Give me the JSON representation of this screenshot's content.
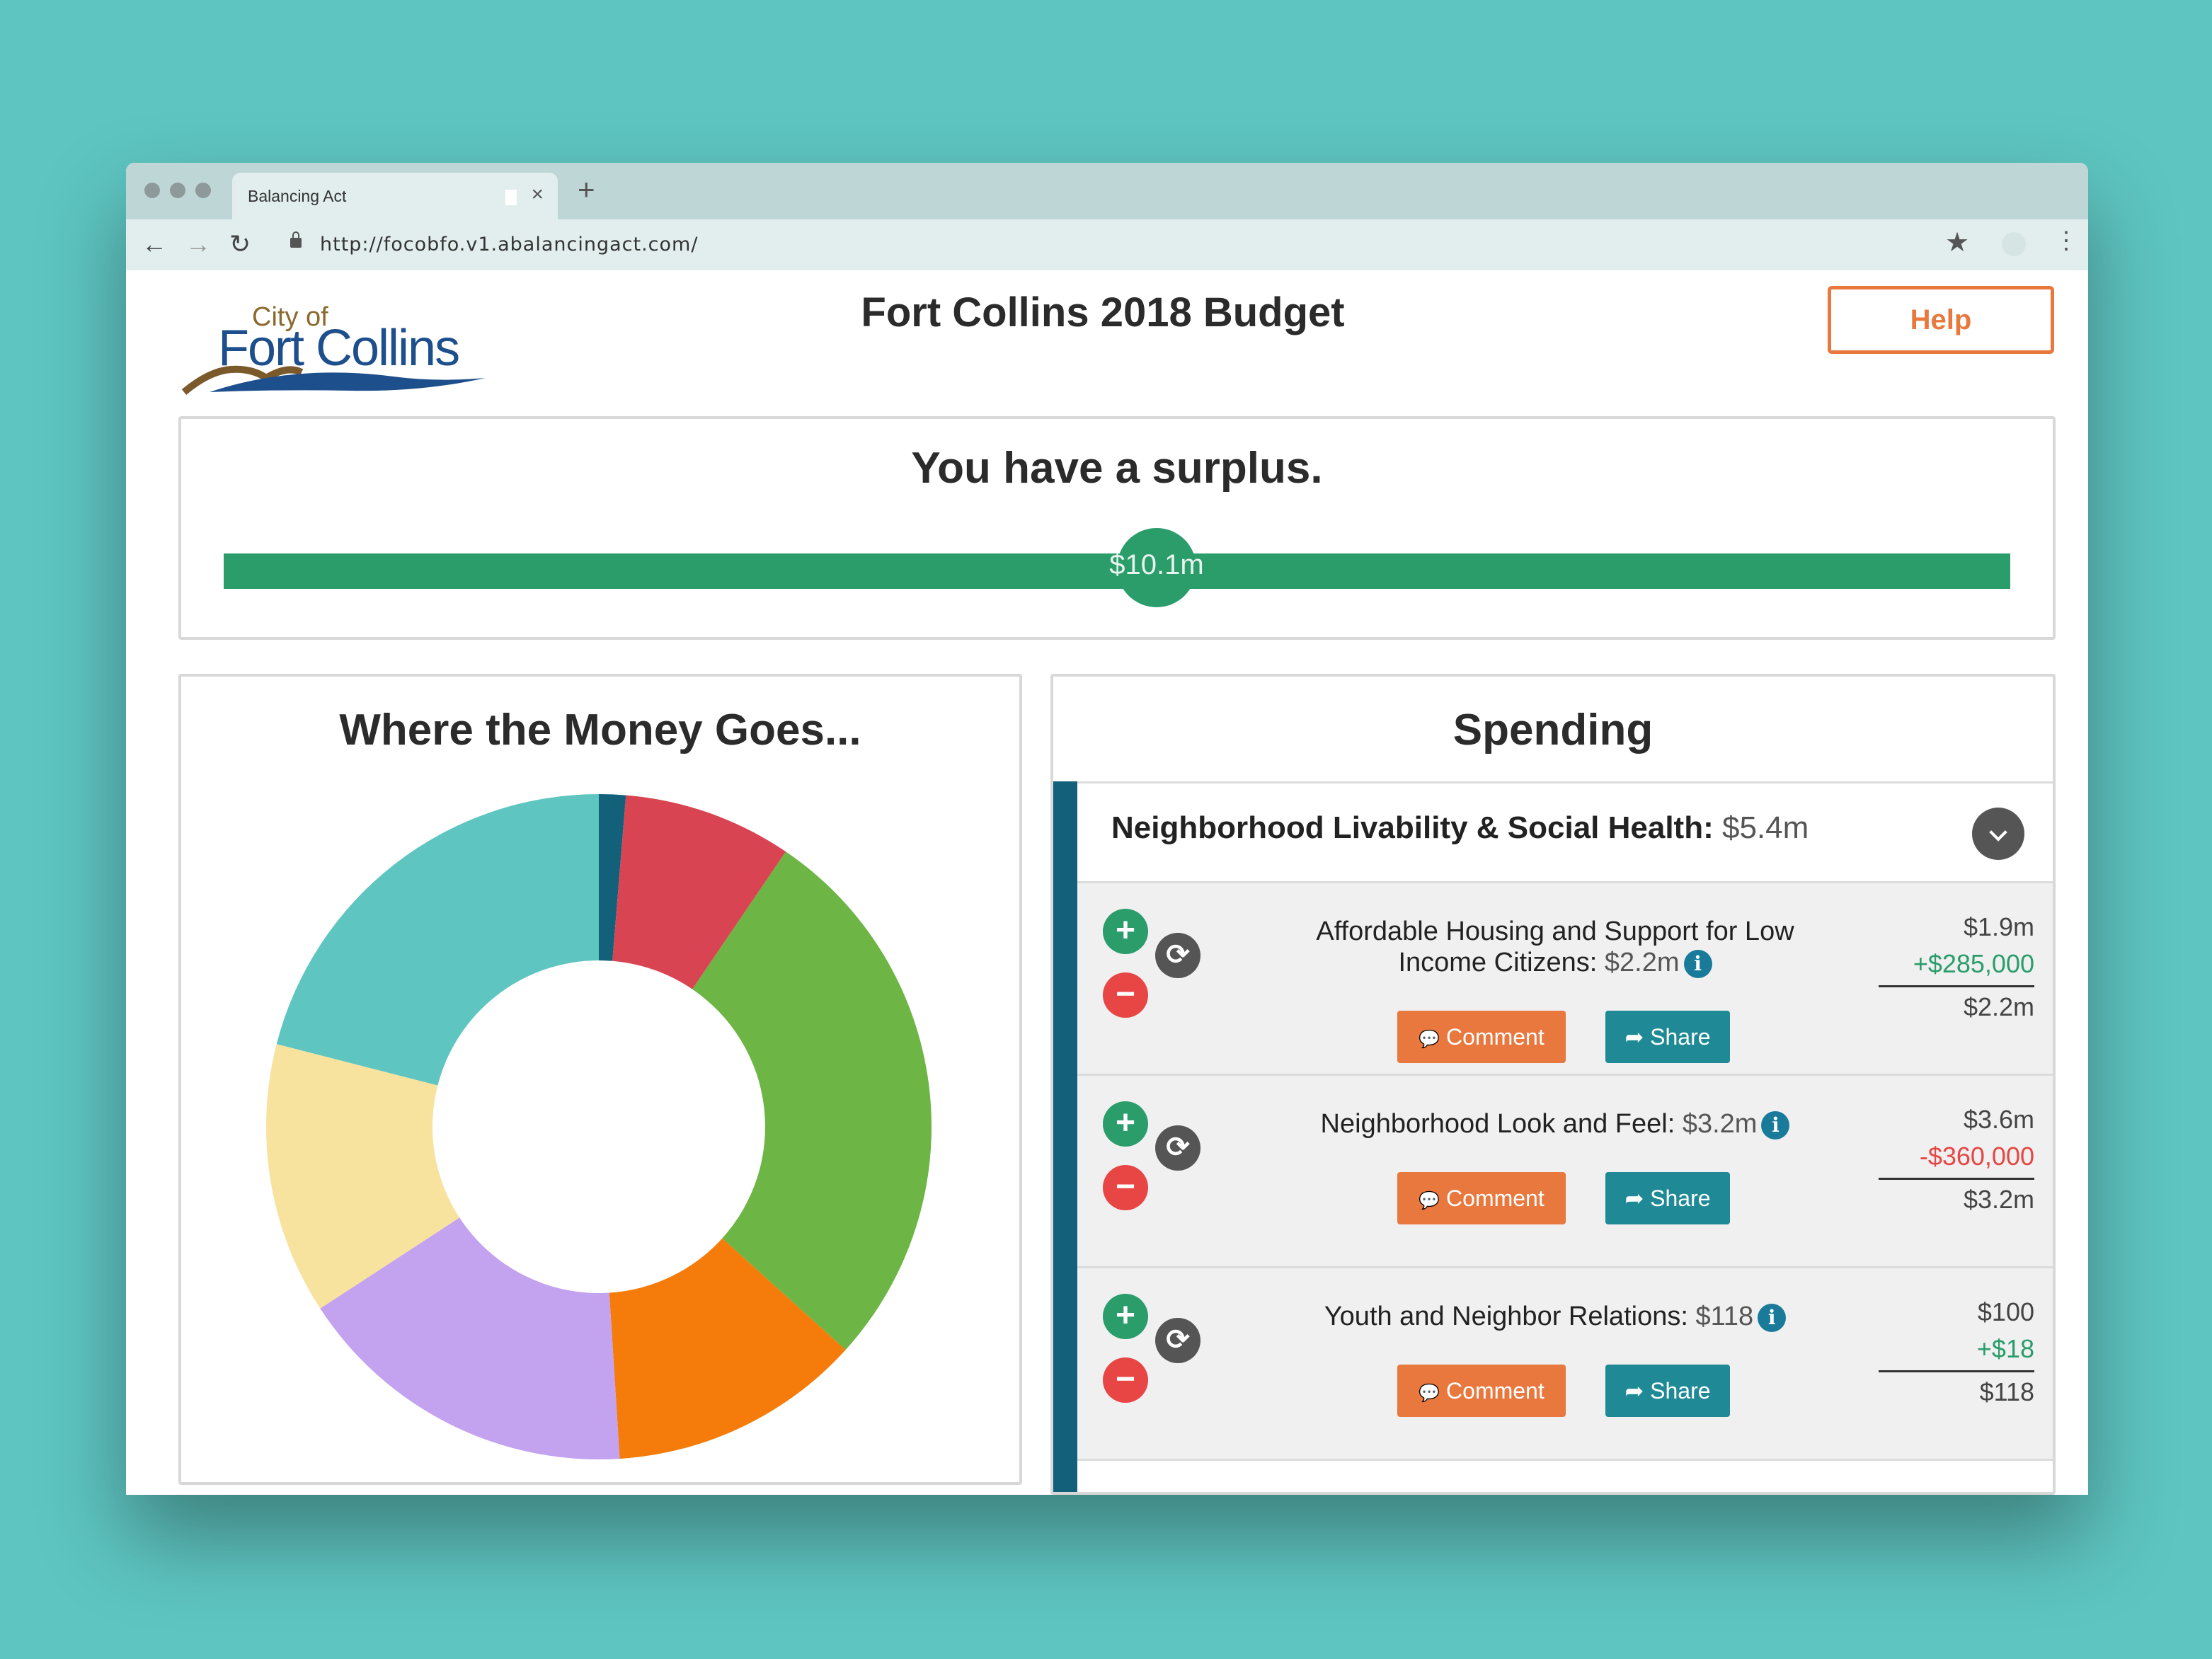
{
  "browser": {
    "tab_title": "Balancing Act",
    "tab_close": "×",
    "new_tab": "+",
    "url": "http://focobfo.v1.abalancingact.com/",
    "back": "←",
    "forward": "→",
    "reload": "↻",
    "bookmark": "★",
    "menu": "⋮"
  },
  "header": {
    "logo_text_top": "City of",
    "logo_text_main": "Fort Collins",
    "title": "Fort Collins 2018 Budget",
    "help_label": "Help"
  },
  "surplus": {
    "message": "You have a surplus.",
    "amount": "$10.1m",
    "bar_color": "#2a9d6b"
  },
  "chart": {
    "title": "Where the Money Goes..."
  },
  "chart_data": {
    "type": "pie",
    "donut": true,
    "title": "Where the Money Goes...",
    "slices": [
      {
        "value": 1.3,
        "color": "#12607a"
      },
      {
        "value": 8.2,
        "color": "#d94452"
      },
      {
        "value": 27.2,
        "color": "#6db544"
      },
      {
        "value": 12.3,
        "color": "#f57c0a"
      },
      {
        "value": 16.8,
        "color": "#c3a2ef"
      },
      {
        "value": 13.2,
        "color": "#f7e29e"
      },
      {
        "value": 21.0,
        "color": "#5ec5c1"
      }
    ]
  },
  "spending": {
    "title": "Spending",
    "category": {
      "name": "Neighborhood Livability & Social Health:",
      "amount": "$5.4m",
      "stripe_color": "#12607a"
    },
    "items": [
      {
        "name": "Affordable Housing and Support for Low Income Citizens:",
        "amount": "$2.2m",
        "base": "$1.9m",
        "delta": "+$285,000",
        "delta_sign": "pos",
        "total": "$2.2m",
        "comment_label": "Comment",
        "share_label": "Share"
      },
      {
        "name": "Neighborhood Look and Feel:",
        "amount": "$3.2m",
        "base": "$3.6m",
        "delta": "-$360,000",
        "delta_sign": "neg",
        "total": "$3.2m",
        "comment_label": "Comment",
        "share_label": "Share"
      },
      {
        "name": "Youth and Neighbor Relations:",
        "amount": "$118",
        "base": "$100",
        "delta": "+$18",
        "delta_sign": "pos",
        "total": "$118",
        "comment_label": "Comment",
        "share_label": "Share"
      }
    ],
    "icons": {
      "plus": "+",
      "minus": "−",
      "reset": "⟳",
      "info": "i",
      "comment": "💬",
      "share": "➦"
    }
  }
}
